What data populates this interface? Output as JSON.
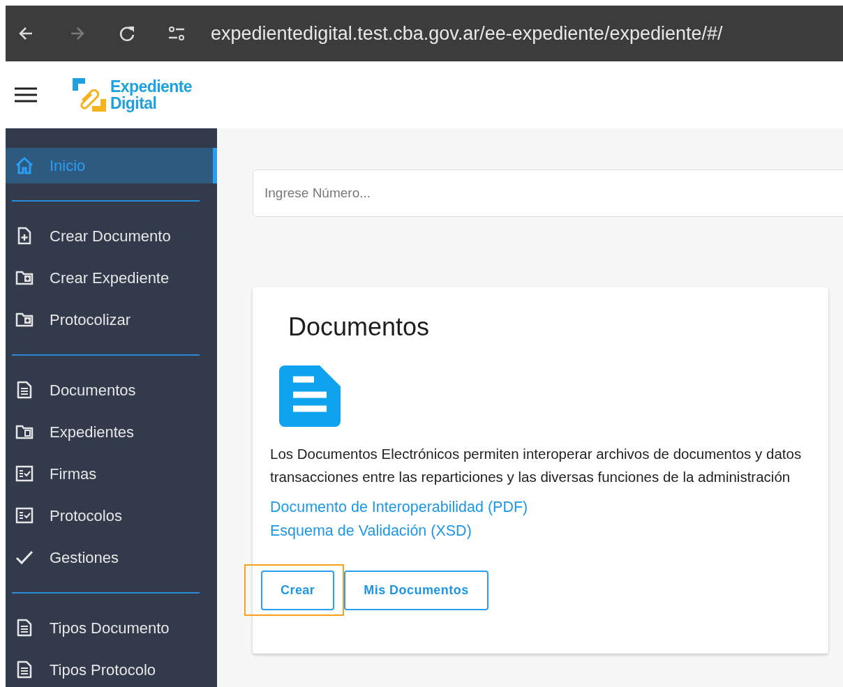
{
  "browser": {
    "nav": [
      {
        "kind": "back",
        "disabled": false
      },
      {
        "kind": "forward",
        "disabled": true
      },
      {
        "kind": "reload",
        "disabled": false
      }
    ],
    "url": "expedientedigital.test.cba.gov.ar/ee-expediente/expediente/#/"
  },
  "header": {
    "logo_lines": [
      "Expediente",
      "Digital"
    ]
  },
  "sidebar": {
    "groups": [
      [
        {
          "kind": "home",
          "label": "Inicio",
          "selected": true
        }
      ],
      [
        {
          "kind": "file-plus",
          "label": "Crear Documento",
          "selected": false
        },
        {
          "kind": "folder-plus",
          "label": "Crear Expediente",
          "selected": false
        },
        {
          "kind": "folder-plus",
          "label": "Protocolizar",
          "selected": false
        }
      ],
      [
        {
          "kind": "document",
          "label": "Documentos",
          "selected": false
        },
        {
          "kind": "folder",
          "label": "Expedientes",
          "selected": false
        },
        {
          "kind": "checklist",
          "label": "Firmas",
          "selected": false
        },
        {
          "kind": "checklist",
          "label": "Protocolos",
          "selected": false
        },
        {
          "kind": "check",
          "label": "Gestiones",
          "selected": false
        }
      ],
      [
        {
          "kind": "document",
          "label": "Tipos Documento",
          "selected": false
        },
        {
          "kind": "document",
          "label": "Tipos Protocolo",
          "selected": false
        }
      ]
    ]
  },
  "search": {
    "placeholder": "Ingrese Número..."
  },
  "card": {
    "title": "Documentos",
    "description": "Los Documentos Electrónicos permiten interoperar archivos de documentos y datos transacciones entre las reparticiones y las diversas funciones de la administración",
    "links": [
      "Documento de Interoperabilidad (PDF)",
      "Esquema de Validación (XSD)"
    ],
    "buttons": [
      {
        "label": "Crear",
        "highlighted": true
      },
      {
        "label": "Mis Documentos",
        "highlighted": false
      }
    ]
  }
}
